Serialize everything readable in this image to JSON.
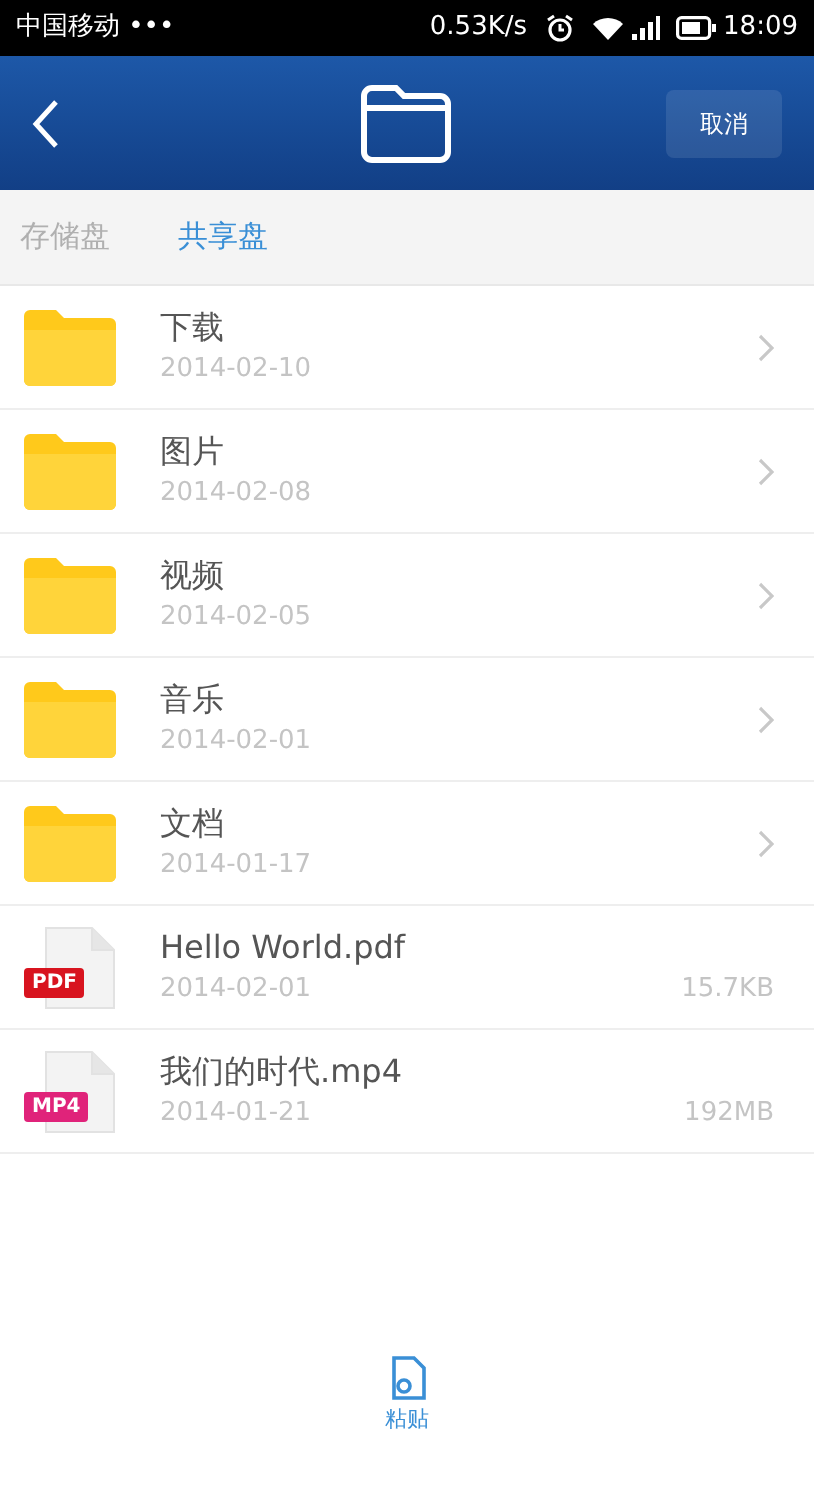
{
  "status_bar": {
    "carrier": "中国移动 •••",
    "speed": "0.53K/s",
    "time": "18:09"
  },
  "header": {
    "cancel": "取消"
  },
  "tabs": [
    {
      "label": "存储盘",
      "selected": false
    },
    {
      "label": "共享盘",
      "selected": true
    }
  ],
  "items": [
    {
      "kind": "folder",
      "name": "下载",
      "date": "2014-02-10"
    },
    {
      "kind": "folder",
      "name": "图片",
      "date": "2014-02-08"
    },
    {
      "kind": "folder",
      "name": "视频",
      "date": "2014-02-05"
    },
    {
      "kind": "folder",
      "name": "音乐",
      "date": "2014-02-01"
    },
    {
      "kind": "folder",
      "name": "文档",
      "date": "2014-01-17"
    },
    {
      "kind": "file",
      "name": "Hello World.pdf",
      "date": "2014-02-01",
      "size": "15.7KB",
      "badge": "PDF",
      "color": "#d8141f"
    },
    {
      "kind": "file",
      "name": "我们的时代.mp4",
      "date": "2014-01-21",
      "size": "192MB",
      "badge": "MP4",
      "color": "#e0237a"
    }
  ],
  "paste": {
    "label": "粘贴"
  }
}
